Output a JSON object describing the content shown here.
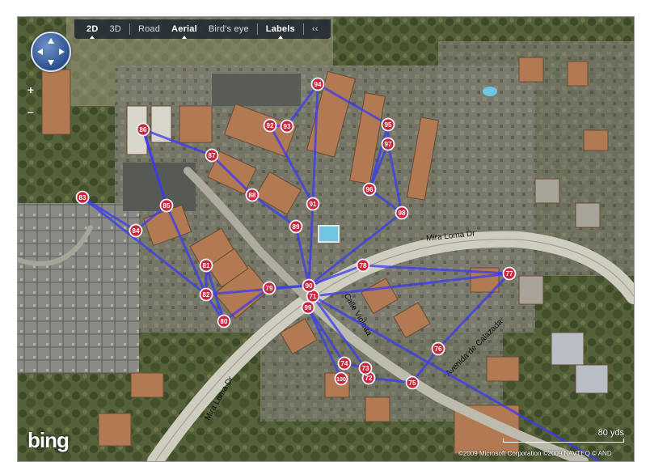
{
  "toolbar": {
    "items": [
      {
        "label": "2D",
        "active": true
      },
      {
        "label": "3D",
        "active": false
      },
      {
        "label": "Road",
        "active": false
      },
      {
        "label": "Aerial",
        "active": true
      },
      {
        "label": "Bird's eye",
        "active": false
      },
      {
        "label": "Labels",
        "active": true
      },
      {
        "label": "‹‹",
        "active": false
      }
    ]
  },
  "controls": {
    "zoom_in": "+",
    "zoom_out": "−"
  },
  "branding": {
    "logo": "bing"
  },
  "scale": {
    "label": "80 yds"
  },
  "copyright": "©2009 Microsoft Corporation   ©2009 NAVTEQ   © AND",
  "streets": [
    "Mira Loma Dr",
    "Mira Loma Dr",
    "Calle Violetta",
    "Avenida de Calazada"
  ],
  "route": {
    "color": "#3b3bf0",
    "marker_fill": "#c8283a",
    "marker_ring": "#f0f0ff",
    "waypoints": [
      "71",
      "72",
      "73",
      "74",
      "75",
      "76",
      "77",
      "78",
      "79",
      "80",
      "81",
      "82",
      "83",
      "84",
      "85",
      "86",
      "87",
      "88",
      "89",
      "90",
      "91",
      "92",
      "93",
      "94",
      "95",
      "96",
      "97",
      "98",
      "99",
      "100"
    ]
  }
}
